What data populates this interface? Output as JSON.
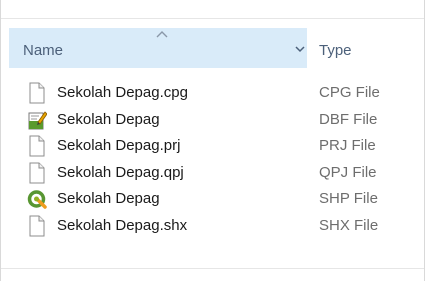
{
  "columns": {
    "name_label": "Name",
    "type_label": "Type"
  },
  "files": [
    {
      "name": "Sekolah Depag.cpg",
      "type": "CPG File",
      "icon": "document-icon"
    },
    {
      "name": "Sekolah Depag",
      "type": "DBF File",
      "icon": "dbf-file-icon"
    },
    {
      "name": "Sekolah Depag.prj",
      "type": "PRJ File",
      "icon": "document-icon"
    },
    {
      "name": "Sekolah Depag.qpj",
      "type": "QPJ File",
      "icon": "document-icon"
    },
    {
      "name": "Sekolah Depag",
      "type": "SHP File",
      "icon": "qgis-icon"
    },
    {
      "name": "Sekolah Depag.shx",
      "type": "SHX File",
      "icon": "document-icon"
    }
  ],
  "colors": {
    "header_highlight": "#d9ebf9",
    "header_text": "#4c607a",
    "filename_text": "#1a1a1a",
    "type_text": "#6d6d6d"
  }
}
